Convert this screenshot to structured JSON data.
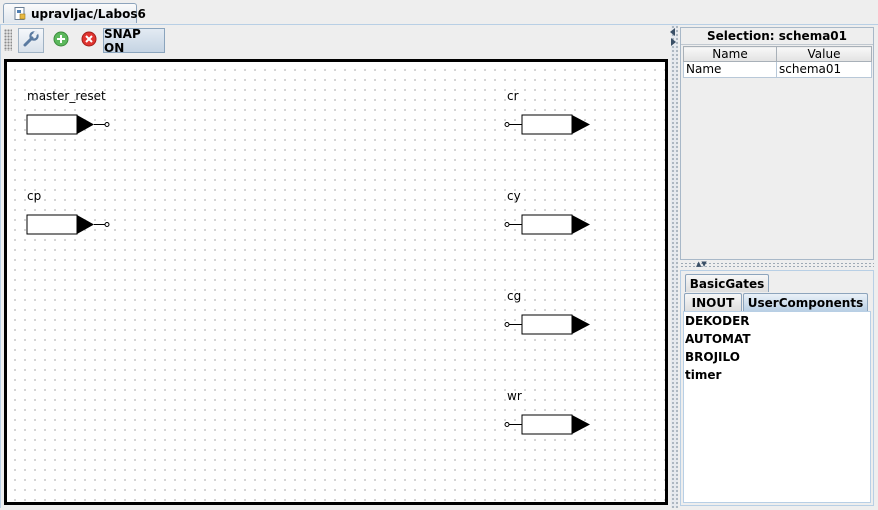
{
  "document_tab": {
    "label": "upravljac/Labos6"
  },
  "toolbar": {
    "snap_label": "SNAP ON"
  },
  "schematic": {
    "inputs": [
      {
        "name": "master_reset"
      },
      {
        "name": "cp"
      }
    ],
    "outputs": [
      {
        "name": "cr"
      },
      {
        "name": "cy"
      },
      {
        "name": "cg"
      },
      {
        "name": "wr"
      }
    ]
  },
  "properties": {
    "title": "Selection: schema01",
    "columns": [
      "Name",
      "Value"
    ],
    "rows": [
      {
        "name": "Name",
        "value": "schema01"
      }
    ]
  },
  "palette": {
    "tabs": {
      "basic": "BasicGates",
      "inout": "INOUT",
      "user": "UserComponents"
    },
    "active_tab": "UserComponents",
    "items": [
      "DEKODER",
      "AUTOMAT",
      "BROJILO",
      "timer"
    ]
  }
}
